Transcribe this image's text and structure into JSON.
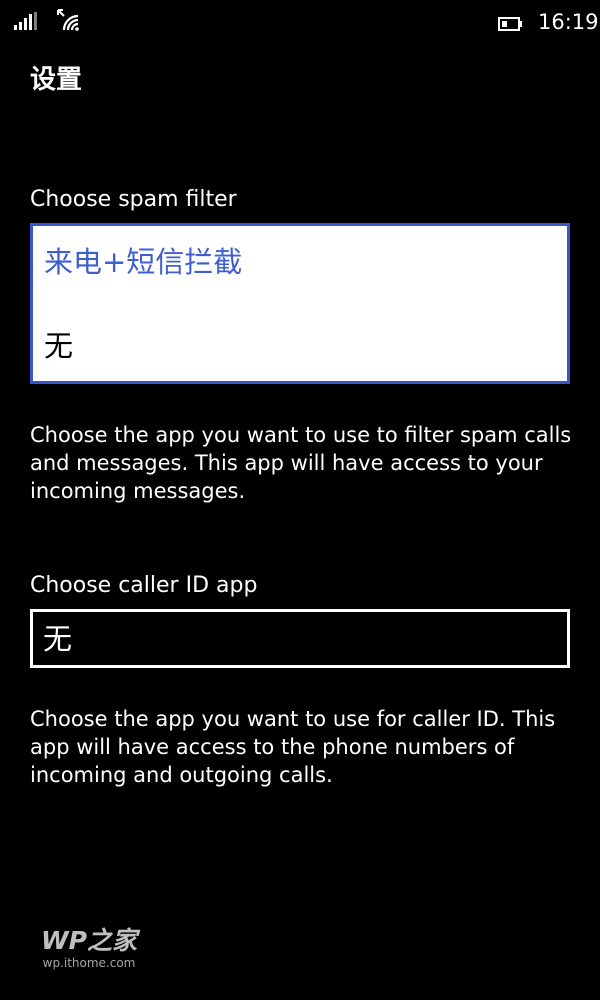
{
  "status_bar": {
    "signal_icon": "signal-bars-icon",
    "wifi_icon": "wifi-icon",
    "battery_icon": "battery-icon",
    "time": "16:19"
  },
  "header": {
    "title": "设置"
  },
  "spam_filter": {
    "label": "Choose spam filter",
    "options": [
      {
        "label": "来电+短信拦截",
        "selected": true
      },
      {
        "label": "无",
        "selected": false
      }
    ],
    "description": "Choose the app you want to use to filter spam calls and messages. This app will have access to your incoming messages."
  },
  "caller_id": {
    "label": "Choose caller ID app",
    "value": "无",
    "description": "Choose the app you want to use for caller ID. This app will have access to the phone numbers of incoming and outgoing calls."
  },
  "watermark": {
    "brand": "WP之家",
    "url": "wp.ithome.com"
  },
  "colors": {
    "accent": "#3a56c9",
    "background": "#000000",
    "foreground": "#ffffff"
  }
}
